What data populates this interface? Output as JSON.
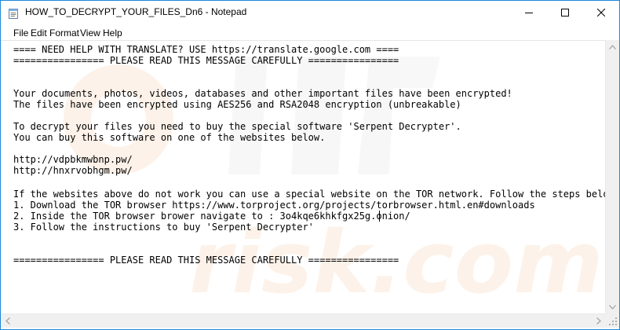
{
  "window": {
    "title": "HOW_TO_DECRYPT_YOUR_FILES_Dn6 - Notepad",
    "icon": "notepad-icon",
    "accent_color": "#1e88d8"
  },
  "menu": [
    {
      "label": "File"
    },
    {
      "label": "Edit"
    },
    {
      "label": "Format"
    },
    {
      "label": "View"
    },
    {
      "label": "Help"
    }
  ],
  "document": {
    "lines": [
      "==== NEED HELP WITH TRANSLATE? USE https://translate.google.com ====",
      "================ PLEASE READ THIS MESSAGE CAREFULLY ================",
      "",
      "",
      "Your documents, photos, videos, databases and other important files have been encrypted!",
      "The files have been encrypted using AES256 and RSA2048 encryption (unbreakable)",
      "",
      "To decrypt your files you need to buy the special software 'Serpent Decrypter'.",
      "You can buy this software on one of the websites below.",
      "",
      "http://vdpbkmwbnp.pw/",
      "http://hnxrvobhgm.pw/",
      "",
      "If the websites above do not work you can use a special website on the TOR network. Follow the steps below",
      "1. Download the TOR browser https://www.torproject.org/projects/torbrowser.html.en#downloads",
      "2. Inside the TOR browser brower navigate to : 3o4kqe6khkfgx25g.onion/",
      "3. Follow the instructions to buy 'Serpent Decrypter'",
      "",
      "",
      "================ PLEASE READ THIS MESSAGE CAREFULLY ================"
    ]
  },
  "watermark": {
    "text": "risk.com"
  }
}
